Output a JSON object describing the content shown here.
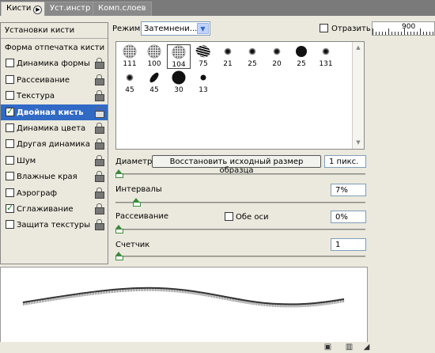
{
  "tabs": [
    {
      "label": "Кисти",
      "active": true
    },
    {
      "label": "Уст.инстр",
      "active": false
    },
    {
      "label": "Комп.слоев",
      "active": false
    }
  ],
  "left_panel": {
    "header": "Установки кисти",
    "items": [
      {
        "label": "Форма отпечатка кисти",
        "checkbox": false,
        "lock": false
      },
      {
        "label": "Динамика формы",
        "checkbox": true,
        "checked": false,
        "lock": true
      },
      {
        "label": "Рассеивание",
        "checkbox": true,
        "checked": false,
        "lock": true
      },
      {
        "label": "Текстура",
        "checkbox": true,
        "checked": false,
        "lock": true
      },
      {
        "label": "Двойная кисть",
        "checkbox": true,
        "checked": true,
        "lock": true,
        "selected": true
      },
      {
        "label": "Динамика цвета",
        "checkbox": true,
        "checked": false,
        "lock": true
      },
      {
        "label": "Другая динамика",
        "checkbox": true,
        "checked": false,
        "lock": true
      },
      {
        "label": "Шум",
        "checkbox": true,
        "checked": false,
        "lock": true
      },
      {
        "label": "Влажные края",
        "checkbox": true,
        "checked": false,
        "lock": true
      },
      {
        "label": "Аэрограф",
        "checkbox": true,
        "checked": false,
        "lock": true
      },
      {
        "label": "Сглаживание",
        "checkbox": true,
        "checked": true,
        "lock": true
      },
      {
        "label": "Защита текстуры",
        "checkbox": true,
        "checked": false,
        "lock": true
      }
    ]
  },
  "mode": {
    "label": "Режим:",
    "value": "Затемнени..."
  },
  "reflect": {
    "label": "Отразить",
    "checked": false
  },
  "ruler": {
    "value": "900"
  },
  "presets": [
    {
      "size": "111",
      "style": "speck"
    },
    {
      "size": "100",
      "style": "speck"
    },
    {
      "size": "104",
      "style": "speck",
      "selected": true
    },
    {
      "size": "75",
      "style": "splat"
    },
    {
      "size": "21",
      "style": "soft"
    },
    {
      "size": "25",
      "style": "soft"
    },
    {
      "size": "20",
      "style": "soft"
    },
    {
      "size": "25",
      "style": "hard"
    },
    {
      "size": "131",
      "style": "soft"
    },
    {
      "size": "45",
      "style": "soft"
    },
    {
      "size": "45",
      "style": "leaf"
    },
    {
      "size": "30",
      "style": "hard"
    },
    {
      "size": "13",
      "style": "hard"
    }
  ],
  "diameter": {
    "label": "Диаметр",
    "restore_label": "Восстановить исходный размер образца",
    "value": "1 пикс.",
    "slider": 0.0
  },
  "intervals": {
    "label": "Интервалы",
    "value": "7%",
    "slider": 0.07
  },
  "scatter": {
    "label": "Рассеивание",
    "both_axes_label": "Обе оси",
    "both_axes_checked": false,
    "value": "0%",
    "slider": 0.0
  },
  "counter": {
    "label": "Счетчик",
    "value": "1",
    "slider": 0.0
  },
  "colors": {
    "accent": "#316ac5",
    "panel_bg": "#ebe9dd",
    "slider_green": "#3d8a3d"
  }
}
